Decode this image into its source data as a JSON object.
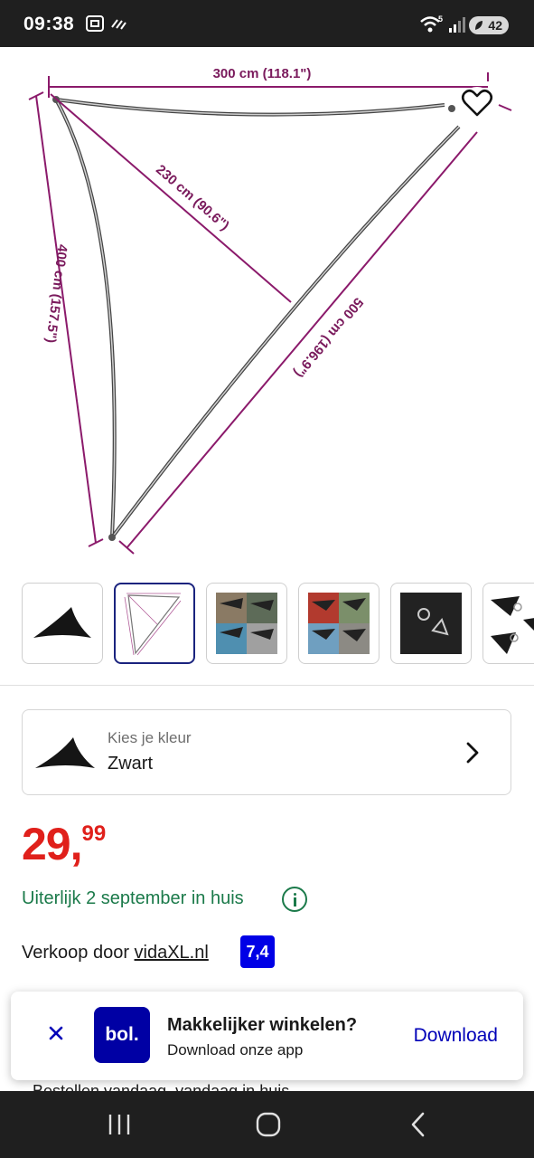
{
  "status_bar": {
    "time": "09:38",
    "battery": "42",
    "icons": [
      "screenshot-icon",
      "nfc-icon",
      "wifi-icon",
      "signal-icon",
      "battery-icon"
    ]
  },
  "product_image": {
    "dim_top": "300 cm (118.1\")",
    "dim_height": "230 cm (90.6\")",
    "dim_left": "400 cm (157.5\")",
    "dim_right": "500 cm (196.9\")"
  },
  "thumbnails": [
    {
      "icon": "black-triangle-shade"
    },
    {
      "icon": "dimension-drawing",
      "selected": true
    },
    {
      "icon": "garden-photo"
    },
    {
      "icon": "terrace-photo"
    },
    {
      "icon": "ring-detail"
    },
    {
      "icon": "corner-detail"
    }
  ],
  "color_selector": {
    "prompt": "Kies je kleur",
    "value": "Zwart"
  },
  "price": {
    "main": "29,",
    "cents": "99"
  },
  "delivery": {
    "text": "Uiterlijk 2 september in huis"
  },
  "seller": {
    "prefix": "Verkoop door ",
    "name": "vidaXL.nl",
    "rating": "7,4"
  },
  "partial_text": "Bestellen vandaag, vandaag in huis",
  "app_banner": {
    "logo": "bol.",
    "title": "Makkelijker winkelen?",
    "subtitle": "Download onze app",
    "cta": "Download"
  },
  "colors": {
    "price": "#e0201b",
    "delivery": "#1b7a4a",
    "brand": "#0000a4",
    "rating_bg": "#0000e6",
    "dimension_line": "#8b1a6b"
  }
}
